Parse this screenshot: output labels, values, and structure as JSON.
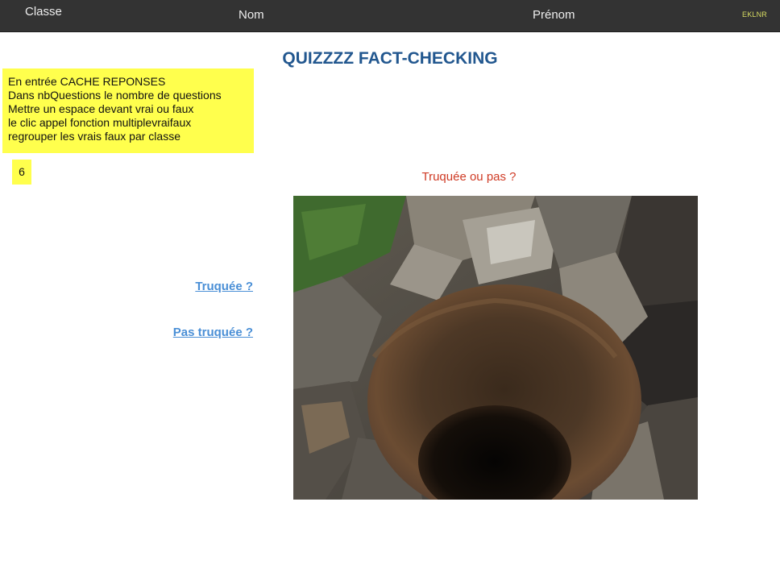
{
  "header": {
    "classe": "Classe",
    "nom": "Nom",
    "prenom": "Prénom",
    "logo": "EKLNR"
  },
  "title": "QUIZZZZ FACT-CHECKING",
  "notes": [
    "En entrée CACHE REPONSES",
    "Dans nbQuestions le nombre de questions",
    "Mettre un espace devant vrai ou faux",
    "le clic appel fonction multiplevraifaux",
    "regrouper les vrais faux par classe"
  ],
  "count": "6",
  "question": "Truquée ou pas ?",
  "answers": {
    "truquee": "Truquée ?",
    "pas_truquee": "Pas truquée ?"
  },
  "colors": {
    "header_bg": "#333333",
    "title": "#22578f",
    "note_bg": "#ffff4d",
    "question": "#cf3b25",
    "link": "#4a8fd6"
  }
}
